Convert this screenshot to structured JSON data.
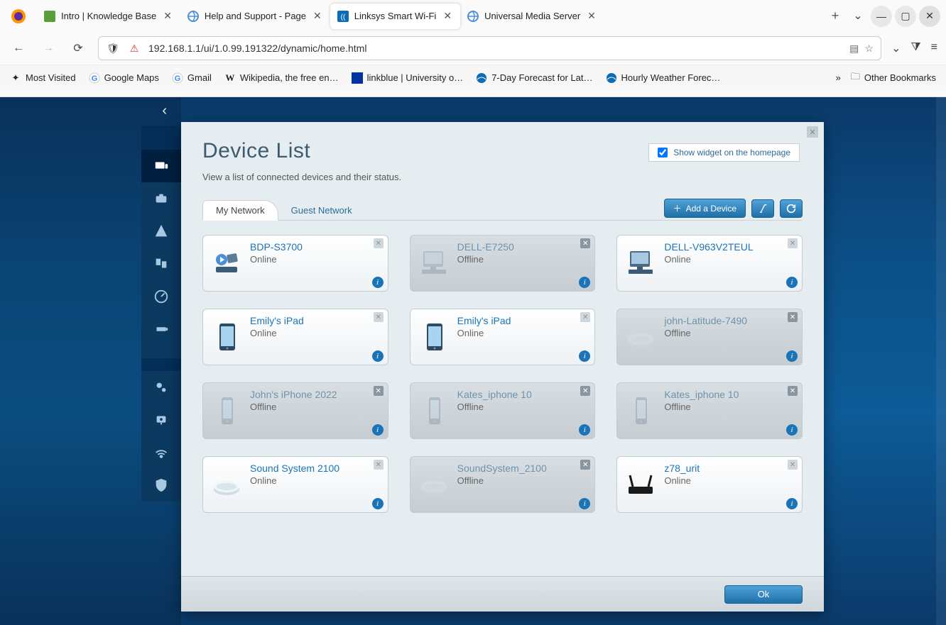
{
  "browser": {
    "tabs": [
      {
        "label": "Intro | Knowledge Base",
        "active": false,
        "favicon": "green"
      },
      {
        "label": "Help and Support - Page",
        "active": false,
        "favicon": "spin"
      },
      {
        "label": "Linksys Smart Wi-Fi",
        "active": true,
        "favicon": "linksys"
      },
      {
        "label": "Universal Media Server",
        "active": false,
        "favicon": "spin"
      }
    ],
    "url": "192.168.1.1/ui/1.0.99.191322/dynamic/home.html",
    "bookmarks": [
      {
        "label": "Most Visited",
        "icon": "star"
      },
      {
        "label": "Google Maps",
        "icon": "g"
      },
      {
        "label": "Gmail",
        "icon": "g"
      },
      {
        "label": "Wikipedia, the free en…",
        "icon": "w"
      },
      {
        "label": "linkblue | University o…",
        "icon": "uk"
      },
      {
        "label": "7-Day Forecast for Lat…",
        "icon": "noaa"
      },
      {
        "label": "Hourly Weather Forec…",
        "icon": "noaa"
      }
    ],
    "other_bookmarks": "Other Bookmarks"
  },
  "panel": {
    "title": "Device List",
    "subtitle": "View a list of connected devices and their status.",
    "show_widget_label": "Show widget on the homepage",
    "show_widget_checked": true,
    "tabs": {
      "my_network": "My Network",
      "guest_network": "Guest Network"
    },
    "add_device": "Add a Device",
    "ok": "Ok"
  },
  "devices": [
    {
      "name": "BDP-S3700",
      "status": "Online",
      "offline": false,
      "icon": "media"
    },
    {
      "name": "DELL-E7250",
      "status": "Offline",
      "offline": true,
      "icon": "desktop"
    },
    {
      "name": "DELL-V963V2TEUL",
      "status": "Online",
      "offline": false,
      "icon": "desktop"
    },
    {
      "name": "Emily's iPad",
      "status": "Online",
      "offline": false,
      "icon": "tablet"
    },
    {
      "name": "Emily's iPad",
      "status": "Online",
      "offline": false,
      "icon": "tablet"
    },
    {
      "name": "john-Latitude-7490",
      "status": "Offline",
      "offline": true,
      "icon": "generic"
    },
    {
      "name": "John's iPhone 2022",
      "status": "Offline",
      "offline": true,
      "icon": "phone"
    },
    {
      "name": "Kates_iphone 10",
      "status": "Offline",
      "offline": true,
      "icon": "phone"
    },
    {
      "name": "Kates_iphone 10",
      "status": "Offline",
      "offline": true,
      "icon": "phone"
    },
    {
      "name": "Sound System 2100",
      "status": "Online",
      "offline": false,
      "icon": "generic"
    },
    {
      "name": "SoundSystem_2100",
      "status": "Offline",
      "offline": true,
      "icon": "generic"
    },
    {
      "name": "z78_urit",
      "status": "Online",
      "offline": false,
      "icon": "router"
    }
  ]
}
